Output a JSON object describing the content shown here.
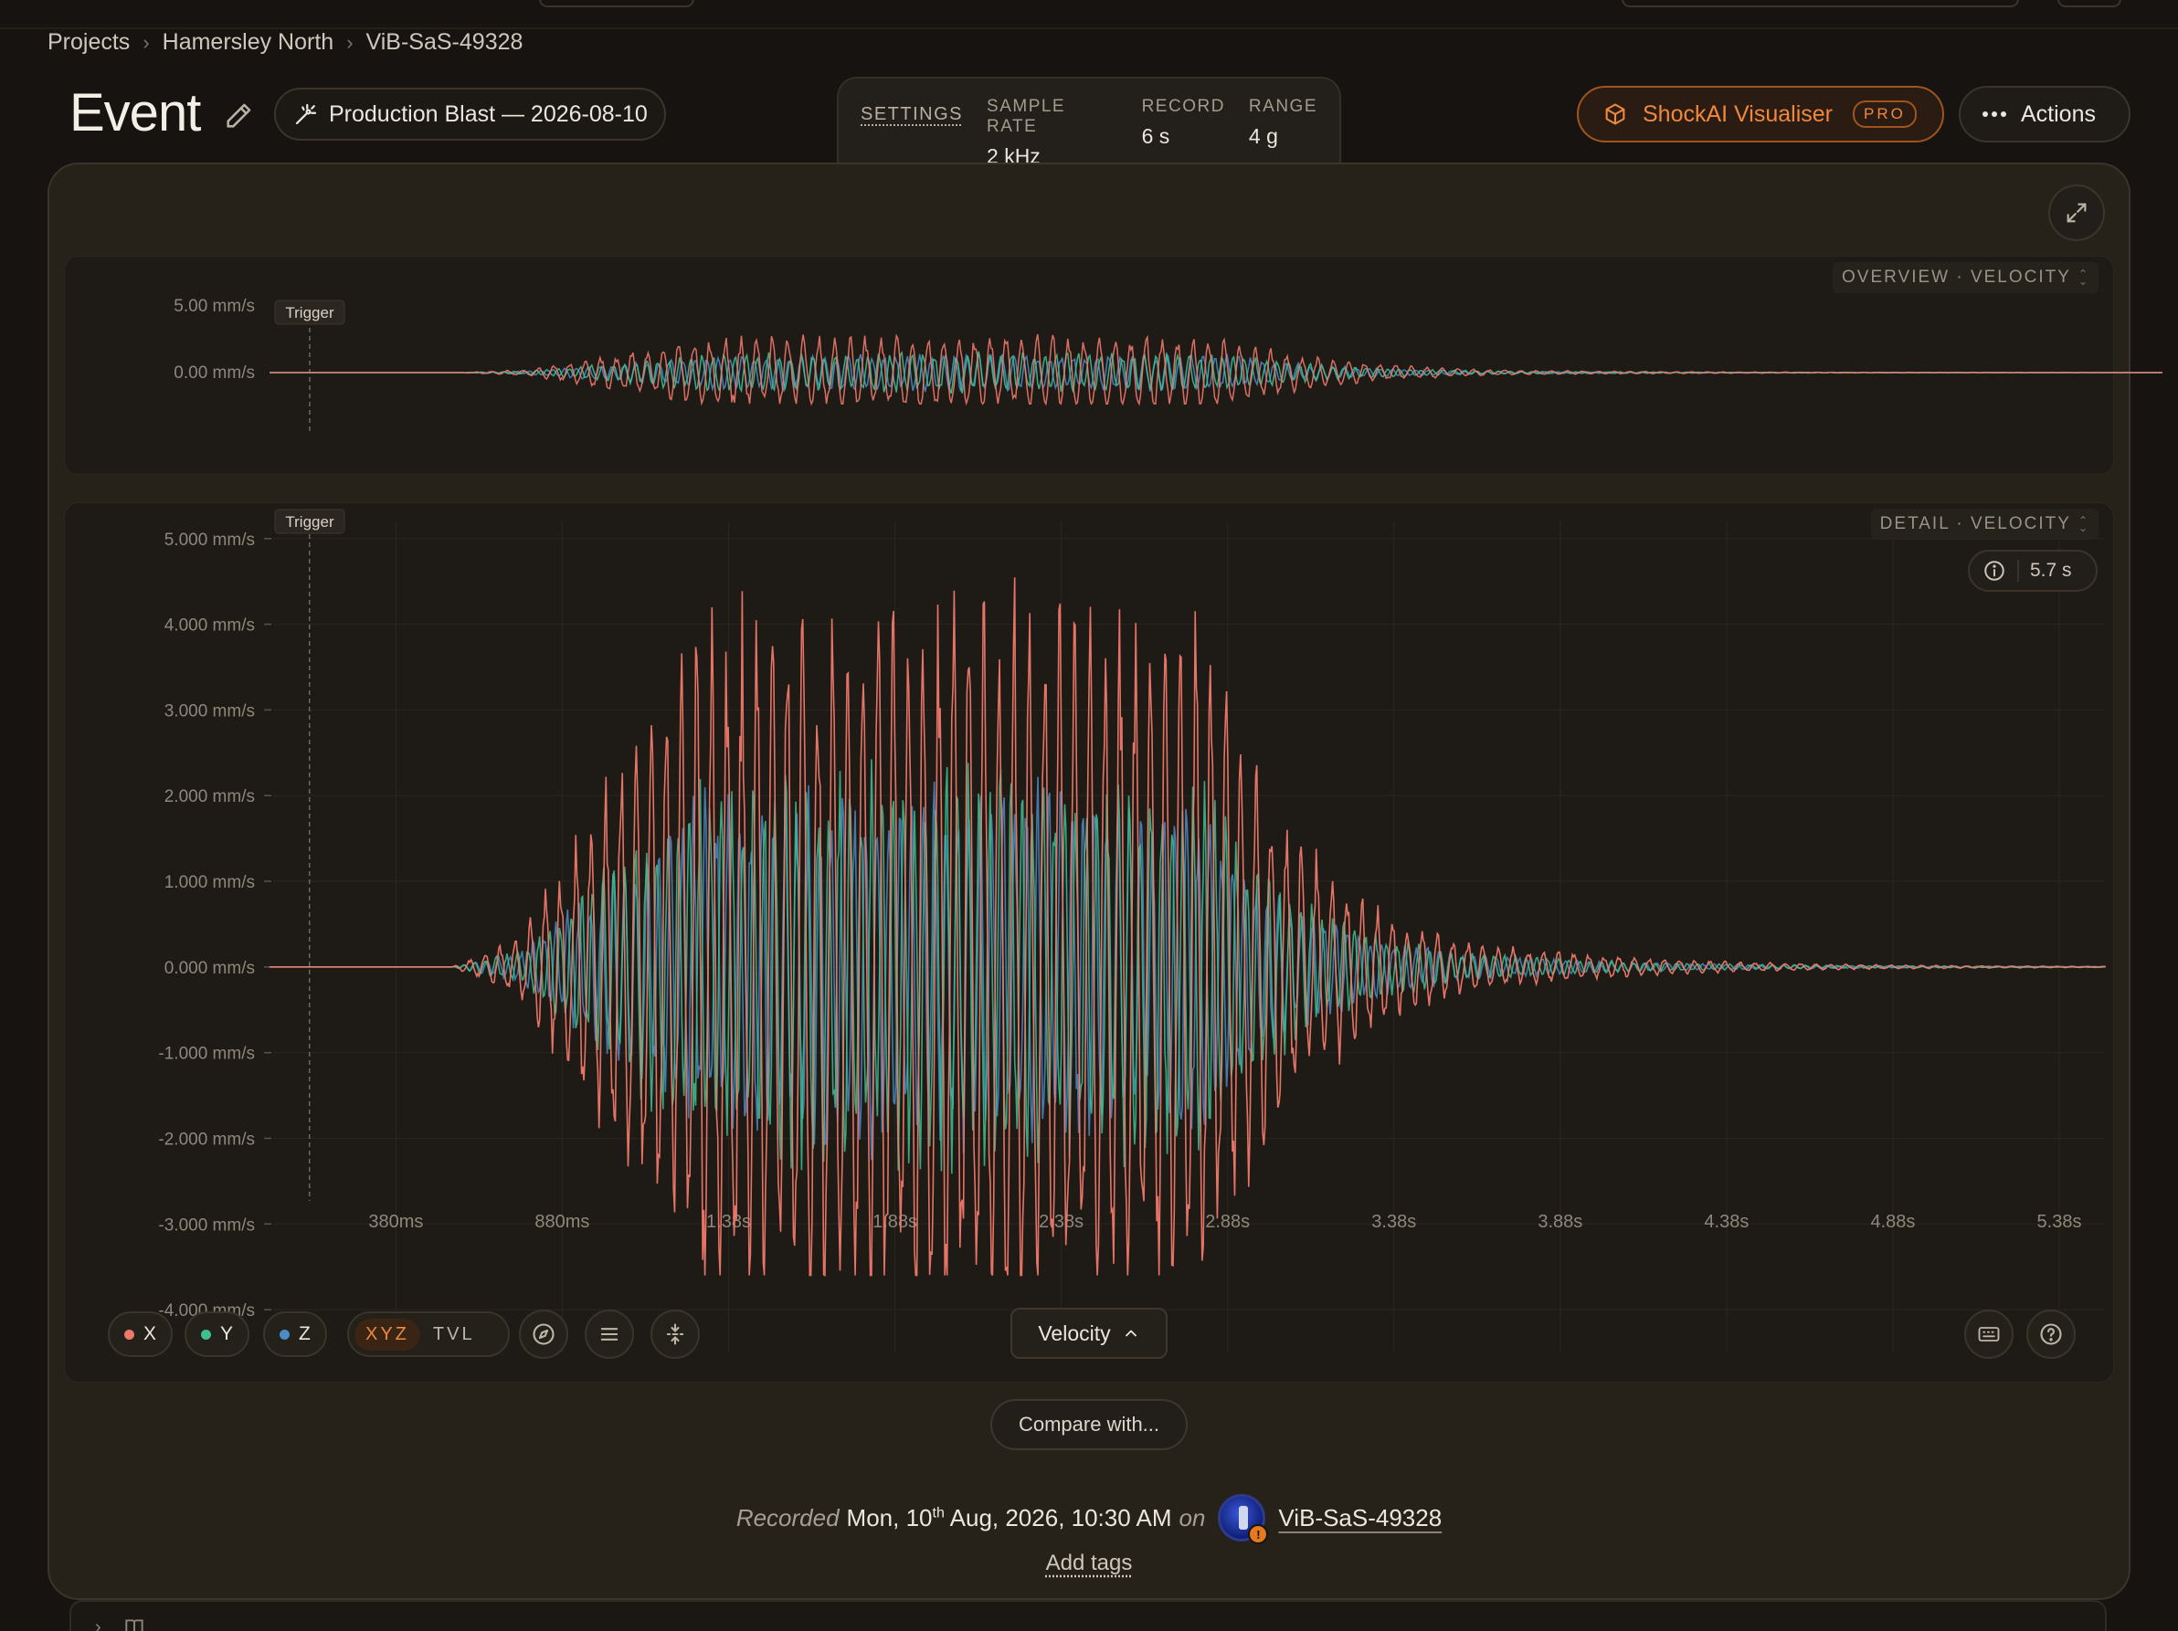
{
  "breadcrumb": [
    "Projects",
    "Hamersley North",
    "ViB-SaS-49328"
  ],
  "header": {
    "title": "Event",
    "event_name": "Production Blast — 2026-08-10"
  },
  "settings": {
    "label": "SETTINGS",
    "sample_rate_label": "SAMPLE RATE",
    "sample_rate": "2 kHz",
    "record_label": "RECORD",
    "record": "6 s",
    "range_label": "RANGE",
    "range": "4 g"
  },
  "shockai": {
    "label": "ShockAI Visualiser",
    "badge": "PRO"
  },
  "actions_label": "Actions",
  "overview": {
    "label": "OVERVIEW · VELOCITY",
    "trigger": "Trigger"
  },
  "detail": {
    "label": "DETAIL · VELOCITY",
    "trigger": "Trigger",
    "duration": "5.7 s"
  },
  "chart_data": [
    {
      "type": "line",
      "title": "OVERVIEW · VELOCITY",
      "y_ticks": [
        "5.00 mm/s",
        "0.00 mm/s"
      ],
      "series": [
        {
          "name": "X",
          "color": "#f0786a"
        },
        {
          "name": "Y",
          "color": "#3fbf91"
        },
        {
          "name": "Z",
          "color": "#4c8ac8"
        }
      ]
    },
    {
      "type": "line",
      "title": "DETAIL · VELOCITY",
      "ylim": [
        -4.5,
        5.2
      ],
      "y_ticks": [
        "5.000 mm/s",
        "4.000 mm/s",
        "3.000 mm/s",
        "2.000 mm/s",
        "1.000 mm/s",
        "0.000 mm/s",
        "-1.000 mm/s",
        "-2.000 mm/s",
        "-3.000 mm/s",
        "-4.000 mm/s"
      ],
      "y_values": [
        5,
        4,
        3,
        2,
        1,
        0,
        -1,
        -2,
        -3,
        -4
      ],
      "x_ticks": [
        "380ms",
        "880ms",
        "1.38s",
        "1.88s",
        "2.38s",
        "2.88s",
        "3.38s",
        "3.88s",
        "4.38s",
        "4.88s",
        "5.38s"
      ],
      "x_values": [
        0.38,
        0.88,
        1.38,
        1.88,
        2.38,
        2.88,
        3.38,
        3.88,
        4.38,
        4.88,
        5.38
      ],
      "xlim": [
        0.0,
        5.52
      ],
      "trigger_x": 0.12,
      "series": [
        {
          "name": "X",
          "color": "#f0786a",
          "peak_positive": 4.7,
          "peak_negative": -3.6
        },
        {
          "name": "Y",
          "color": "#3fbf91",
          "peak_positive": 2.5,
          "peak_negative": -2.5
        },
        {
          "name": "Z",
          "color": "#4c8ac8",
          "peak_positive": 2.3,
          "peak_negative": -2.3
        }
      ]
    }
  ],
  "toolbar": {
    "axes": [
      {
        "label": "X",
        "color": "#f0786a"
      },
      {
        "label": "Y",
        "color": "#3fbf91"
      },
      {
        "label": "Z",
        "color": "#4c8ac8"
      }
    ],
    "mode_on": "XYZ",
    "mode_off": "TVL",
    "velocity_label": "Velocity"
  },
  "compare_label": "Compare with...",
  "recorded": {
    "prefix": "Recorded",
    "date_day": "Mon, 10",
    "date_suffix": "th",
    "date_rest": "Aug, 2026, 10:30 AM",
    "on": "on",
    "device": "ViB-SaS-49328"
  },
  "add_tags": "Add tags"
}
